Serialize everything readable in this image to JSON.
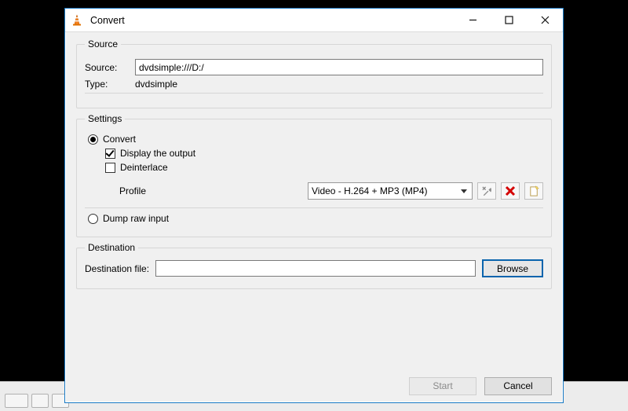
{
  "window": {
    "title": "Convert"
  },
  "source": {
    "legend": "Source",
    "source_label": "Source:",
    "source_value": "dvdsimple:///D:/",
    "type_label": "Type:",
    "type_value": "dvdsimple"
  },
  "settings": {
    "legend": "Settings",
    "convert_label": "Convert",
    "display_output_label": "Display the output",
    "deinterlace_label": "Deinterlace",
    "profile_label": "Profile",
    "profile_value": "Video - H.264 + MP3 (MP4)",
    "dump_label": "Dump raw input"
  },
  "destination": {
    "legend": "Destination",
    "file_label": "Destination file:",
    "file_value": "",
    "browse_label": "Browse"
  },
  "footer": {
    "start_label": "Start",
    "cancel_label": "Cancel"
  }
}
